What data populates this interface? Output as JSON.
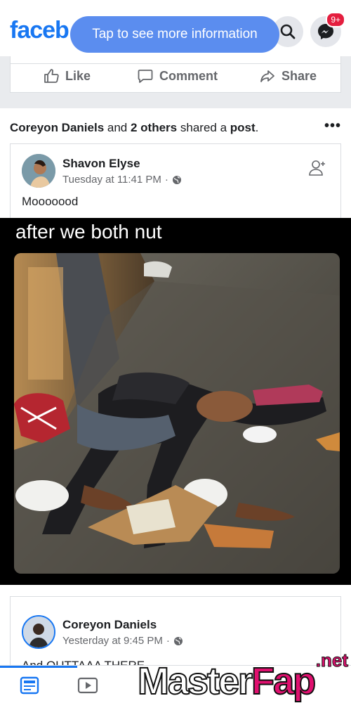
{
  "app": {
    "logo": "faceb",
    "notification_count": "9+"
  },
  "toast": {
    "text": "Tap to see more information"
  },
  "post1": {
    "actions": {
      "like": "Like",
      "comment": "Comment",
      "share": "Share"
    }
  },
  "shared": {
    "user": "Coreyon Daniels",
    "and_text": "and",
    "others": "2 others",
    "shared_text": "shared a",
    "post_word": "post",
    "period": "."
  },
  "inner_post": {
    "author": "Shavon Elyse",
    "timestamp": "Tuesday at 11:41 PM",
    "separator": "·",
    "text": "Mooooood"
  },
  "meme": {
    "caption": "after we both nut"
  },
  "comment_post": {
    "author": "Coreyon Daniels",
    "timestamp": "Yesterday at 9:45 PM",
    "separator": "·",
    "text_partial": "And OUTTAAA THERE"
  },
  "watermark": {
    "brand_a": "Master",
    "brand_b": "Fap",
    "tld": ".net"
  },
  "colors": {
    "brand": "#1877f2",
    "toast": "#5b8def",
    "badge": "#e41e3f",
    "watermark": "#e0106f"
  },
  "icons": [
    "search-icon",
    "messenger-icon",
    "like-icon",
    "comment-icon",
    "share-icon",
    "more-icon",
    "globe-icon",
    "add-friend-icon",
    "news-feed-icon",
    "video-icon"
  ]
}
